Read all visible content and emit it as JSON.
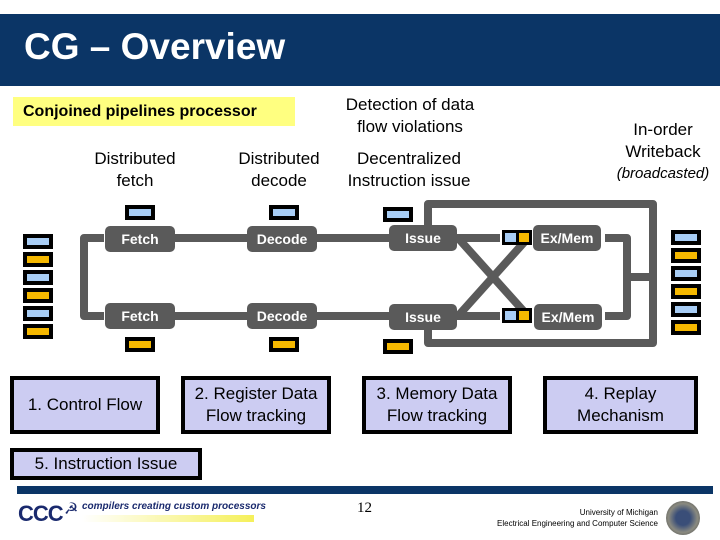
{
  "title": "CG – Overview",
  "subtitle": "Conjoined pipelines processor",
  "headers": {
    "fetch": [
      "Distributed",
      "fetch"
    ],
    "decode": [
      "Distributed",
      "decode"
    ],
    "detection": [
      "Detection of data",
      "flow violations"
    ],
    "issue": [
      "Decentralized",
      "Instruction issue"
    ],
    "writeback": [
      "In-order",
      "Writeback"
    ],
    "writeback_note": "(broadcasted)"
  },
  "pipelines": [
    {
      "stages": [
        "Fetch",
        "Decode",
        "Issue",
        "Ex/Mem"
      ],
      "color": "blue"
    },
    {
      "stages": [
        "Fetch",
        "Decode",
        "Issue",
        "Ex/Mem"
      ],
      "color": "gold"
    }
  ],
  "register_file_pattern": [
    "blue",
    "gold",
    "blue",
    "gold",
    "blue",
    "gold"
  ],
  "colors": {
    "title_bar": "#0b3566",
    "stage": "#5a5a5a",
    "blue": "#a8cdf5",
    "gold": "#f5b800",
    "box": "#ccccf2",
    "highlight": "#ffff80"
  },
  "mechanisms": [
    "1. Control Flow",
    "2. Register Data Flow tracking",
    "3. Memory Data Flow tracking",
    "4. Replay Mechanism",
    "5. Instruction Issue"
  ],
  "mechanism_lines": [
    [
      "1. Control Flow"
    ],
    [
      "2. Register Data",
      "Flow tracking"
    ],
    [
      "3. Memory Data",
      "Flow tracking"
    ],
    [
      "4. Replay",
      "Mechanism"
    ],
    [
      "5. Instruction Issue"
    ]
  ],
  "footer": {
    "logo_text": "CCC",
    "tagline": "compilers creating custom processors",
    "page_number": "12",
    "university": "University of Michigan",
    "department": "Electrical Engineering and Computer Science"
  }
}
